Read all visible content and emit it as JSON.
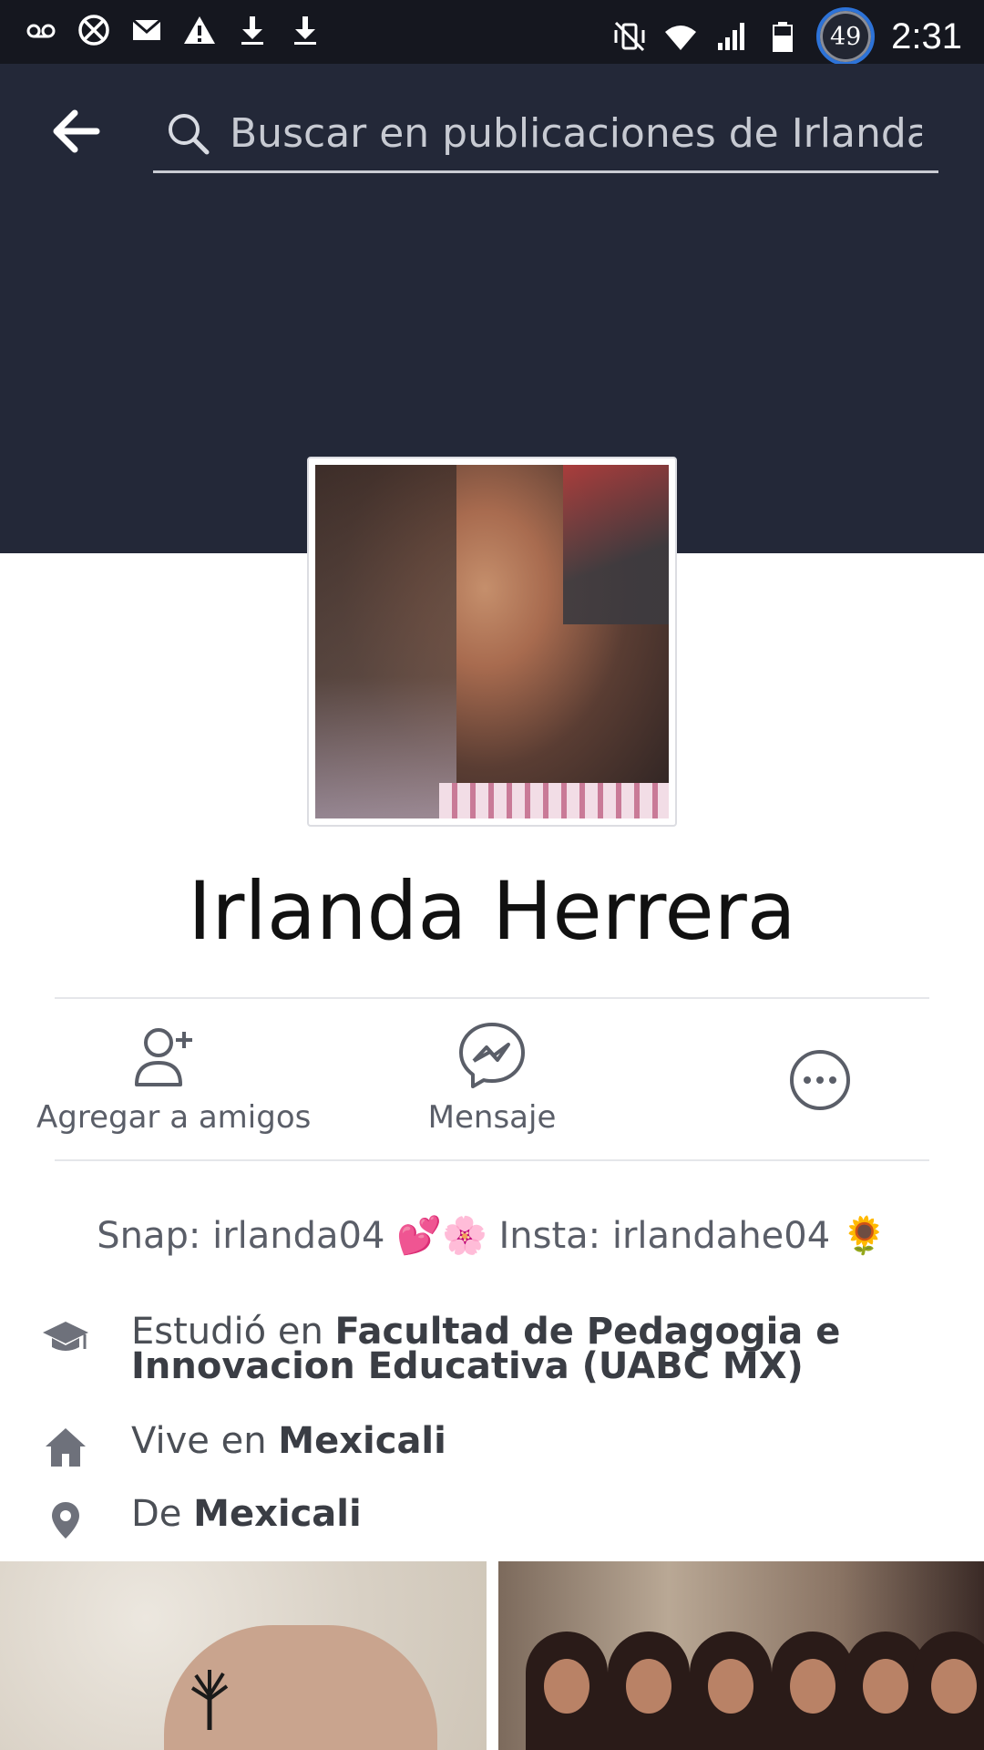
{
  "status_bar": {
    "time": "2:31",
    "badge": "49",
    "left_icons": [
      "voicemail-icon",
      "blocked-icon",
      "mail-icon",
      "warning-icon",
      "download-icon",
      "download-icon"
    ],
    "right_icons": [
      "vibrate-mute-icon",
      "wifi-icon",
      "signal-icon",
      "battery-icon"
    ]
  },
  "header": {
    "search_placeholder": "Buscar en publicaciones de Irlanda"
  },
  "profile": {
    "name": "Irlanda Herrera"
  },
  "actions": [
    {
      "label": "Agregar a amigos",
      "icon": "add-friend-icon"
    },
    {
      "label": "Mensaje",
      "icon": "messenger-icon"
    },
    {
      "label": "",
      "icon": "more-icon"
    }
  ],
  "bio": {
    "text_snap": "Snap: irlanda04",
    "emoji_1": "💕🌸",
    "text_insta": "Insta: irlandahe04",
    "emoji_2": "🌻"
  },
  "info": {
    "study_prefix": "Estudió en",
    "study_place": "Facultad de Pedagogia e Innovacion Educativa (UABC MX)",
    "lives_prefix": "Vive en",
    "lives_place": "Mexicali",
    "from_prefix": "De",
    "from_place": "Mexicali"
  },
  "colors": {
    "header_bg": "#232838",
    "status_bg": "#15171f",
    "text_muted": "#5a5e68",
    "icon_gray": "#6e717b"
  }
}
